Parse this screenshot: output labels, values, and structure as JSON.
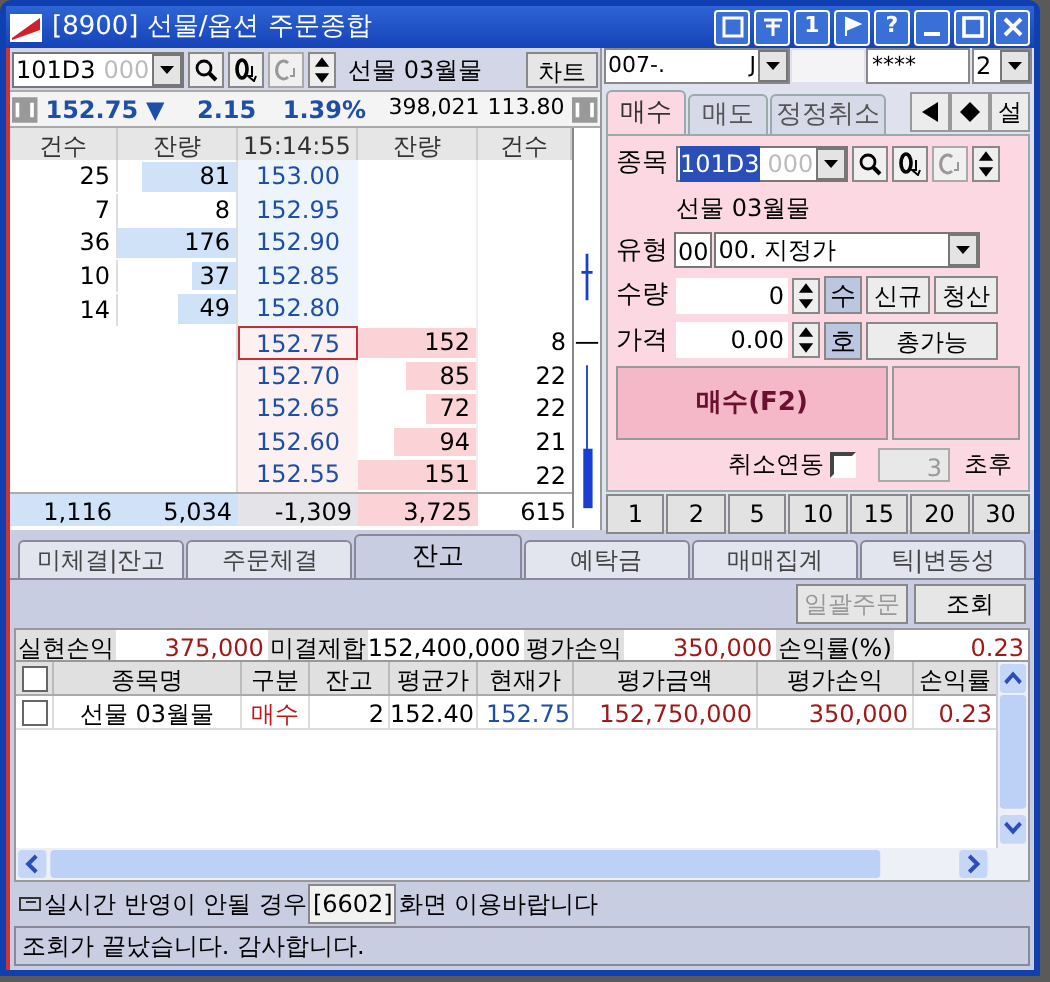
{
  "window": {
    "title": "[8900] 선물/옵션 주문종합",
    "buttons": [
      {
        "kind": "restore"
      },
      {
        "kind": "pin"
      },
      {
        "kind": "text",
        "label": "1"
      },
      {
        "kind": "flag"
      },
      {
        "kind": "text",
        "label": "?"
      },
      {
        "kind": "minimize"
      },
      {
        "kind": "maximize"
      },
      {
        "kind": "close"
      }
    ]
  },
  "symbol_bar": {
    "code": "101D3",
    "suffix": "000",
    "name": "선물 03월물",
    "chart_button": "차트"
  },
  "account_bar": {
    "account": "007-.",
    "branch": "J",
    "password": "****",
    "count": "2"
  },
  "quote": {
    "price": "152.75",
    "arrow": "▼",
    "change": "2.15",
    "rate": "1.39%",
    "volume": "398,021",
    "basis": "113.80"
  },
  "orderbook": {
    "columns": [
      "건수",
      "잔량",
      "15:14:55",
      "잔량",
      "건수"
    ],
    "rows": [
      {
        "kind": "bid",
        "count": "25",
        "qty": "81",
        "price": "153.00",
        "level": 0.8,
        "selected": false
      },
      {
        "kind": "bid",
        "count": "7",
        "qty": "8",
        "price": "152.95",
        "selected": false
      },
      {
        "kind": "bid",
        "count": "36",
        "qty": "176",
        "price": "152.90",
        "level": 1.0,
        "selected": false
      },
      {
        "kind": "bid",
        "count": "10",
        "qty": "37",
        "price": "152.85",
        "level": 0.38,
        "selected": false
      },
      {
        "kind": "bid",
        "count": "14",
        "qty": "49",
        "price": "152.80",
        "level": 0.5,
        "selected": false
      },
      {
        "kind": "ask",
        "count": "8",
        "qty": "152",
        "price": "152.75",
        "level": 1.0,
        "selected": true
      },
      {
        "kind": "ask",
        "count": "22",
        "qty": "85",
        "price": "152.70",
        "level": 0.6,
        "selected": false
      },
      {
        "kind": "ask",
        "count": "22",
        "qty": "72",
        "price": "152.65",
        "level": 0.42,
        "selected": false
      },
      {
        "kind": "ask",
        "count": "21",
        "qty": "94",
        "price": "152.60",
        "level": 0.7,
        "selected": false
      },
      {
        "kind": "ask",
        "count": "22",
        "qty": "151",
        "price": "152.55",
        "level": 1.0,
        "selected": false
      }
    ],
    "totals": [
      "1,116",
      "5,034",
      "-1,309",
      "3,725",
      "615"
    ]
  },
  "order_panel": {
    "tabs": [
      {
        "label": "매수",
        "selected": true
      },
      {
        "label": "매도",
        "selected": false
      },
      {
        "label": "정정취소",
        "selected": false
      }
    ],
    "tool_buttons": [
      {
        "kind": "left"
      },
      {
        "kind": "diamond"
      },
      {
        "kind": "text",
        "label": "설"
      }
    ],
    "symbol_label": "종목",
    "code": "101D3",
    "suffix": "000",
    "name": "선물 03월물",
    "type_label": "유형",
    "type_code": "00",
    "type_value": "00. 지정가",
    "qty_label": "수량",
    "qty_value": "0",
    "qty_unit": "수",
    "new_button": "신규",
    "close_button": "청산",
    "price_label": "가격",
    "price_value": "0.00",
    "price_unit": "호",
    "max_button": "총가능",
    "submit_button": "매수(F2)",
    "link_label": "취소연동",
    "link_checked": false,
    "delay_value": "3",
    "delay_unit": "초후",
    "quick_buttons": [
      "1",
      "2",
      "5",
      "10",
      "15",
      "20",
      "30"
    ]
  },
  "bottom_tabs": [
    {
      "label": "미체결|잔고",
      "selected": false
    },
    {
      "label": "주문체결",
      "selected": false
    },
    {
      "label": "잔고",
      "selected": true
    },
    {
      "label": "예탁금",
      "selected": false
    },
    {
      "label": "매매집계",
      "selected": false
    },
    {
      "label": "틱|변동성",
      "selected": false
    }
  ],
  "toolbar": [
    {
      "label": "일괄주문",
      "disabled": true
    },
    {
      "label": "조회",
      "disabled": false
    }
  ],
  "summary": [
    {
      "label": "실현손익",
      "value": "375,000"
    },
    {
      "label": "미결제합",
      "value": "152,400,000"
    },
    {
      "label": "평가손익",
      "value": "350,000"
    },
    {
      "label": "손익률(%)",
      "value": "0.23"
    }
  ],
  "table": {
    "all_checked": false,
    "columns": [
      "종목명",
      "구분",
      "잔고",
      "평균가",
      "현재가",
      "평가금액",
      "평가손익",
      "손익률"
    ],
    "rows": [
      {
        "checked": false,
        "cells": [
          "선물 03월물",
          "매수",
          "2",
          "152.40",
          "152.75",
          "152,750,000",
          "350,000",
          "0.23"
        ]
      }
    ]
  },
  "notice": {
    "before": "실시간 반영이 안될 경우",
    "code": "[6602]",
    "after": "화면 이용바랍니다"
  },
  "status_bar": "조회가 끝났습니다. 감사합니다."
}
